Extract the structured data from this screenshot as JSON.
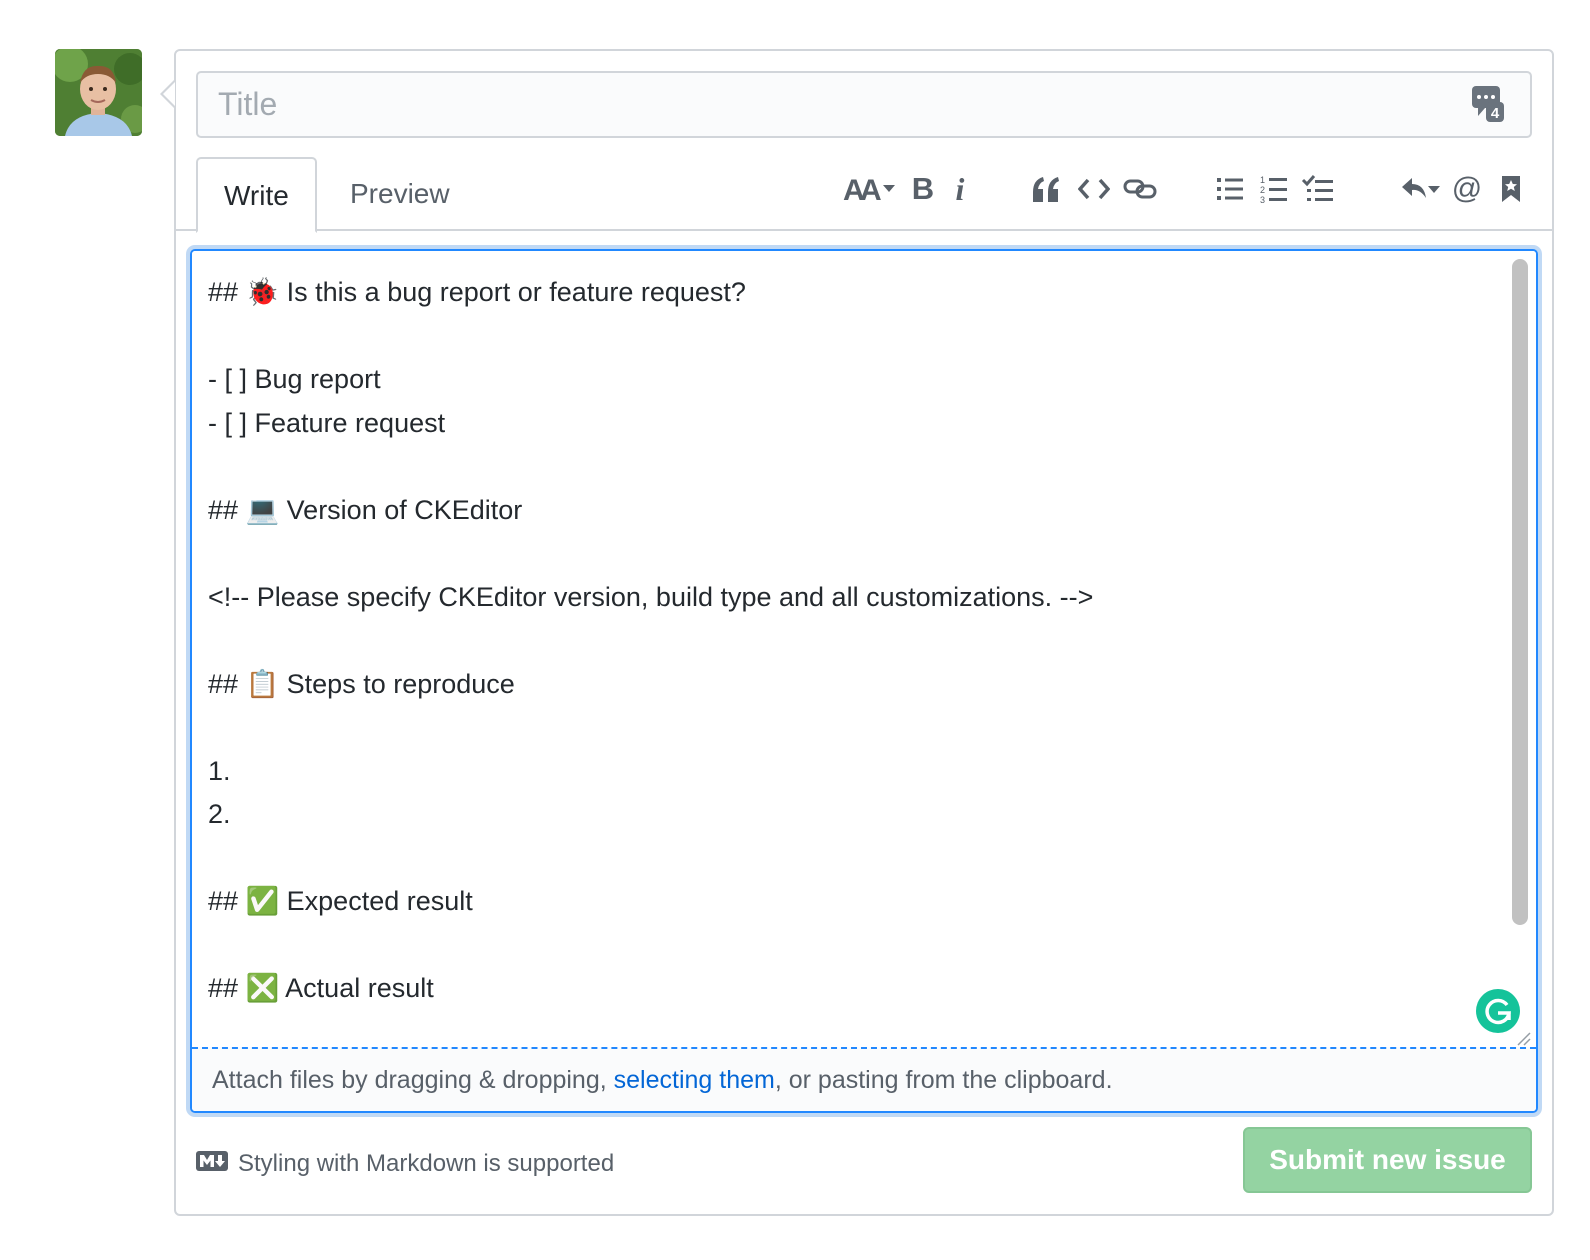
{
  "title_input": {
    "placeholder": "Title",
    "value": ""
  },
  "tabs": [
    {
      "label": "Write",
      "active": true
    },
    {
      "label": "Preview",
      "active": false
    }
  ],
  "toolbar": {
    "items": [
      "text-size-icon",
      "bold-icon",
      "italic-icon",
      "quote-icon",
      "code-icon",
      "link-icon",
      "bullet-list-icon",
      "numbered-list-icon",
      "task-list-icon",
      "reply-icon",
      "mention-icon",
      "reference-icon"
    ],
    "bold_label": "B",
    "italic_label": "i",
    "mention_label": "@"
  },
  "editor": {
    "body": "## 🐞 Is this a bug report or feature request?\n\n- [ ] Bug report\n- [ ] Feature request\n\n## 💻 Version of CKEditor\n\n<!-- Please specify CKEditor version, build type and all customizations. -->\n\n## 📋 Steps to reproduce\n\n1.\n2.\n\n## ✅ Expected result\n\n## ❎ Actual result"
  },
  "dropzone": {
    "prefix": "Attach files by dragging & dropping, ",
    "link": "selecting them",
    "suffix": ", or pasting from the clipboard."
  },
  "footer": {
    "markdown_note": "Styling with Markdown is supported",
    "submit_label": "Submit new issue"
  },
  "colors": {
    "focus_blue": "#2188ff",
    "link_blue": "#0366d6",
    "submit_disabled_green": "#94d3a2",
    "grammarly_green": "#15c39a"
  }
}
